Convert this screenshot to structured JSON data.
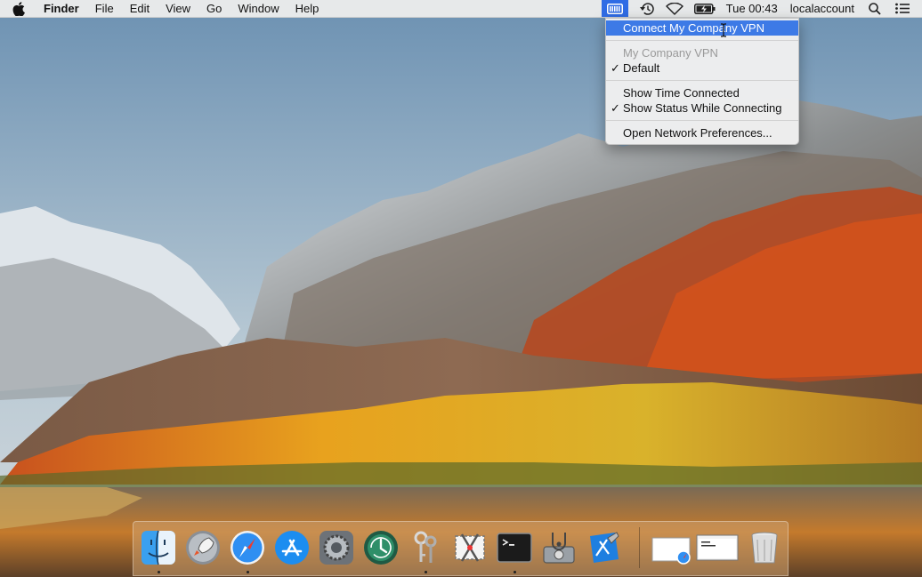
{
  "menubar": {
    "app_name": "Finder",
    "menus": [
      "File",
      "Edit",
      "View",
      "Go",
      "Window",
      "Help"
    ],
    "clock": "Tue 00:43",
    "user": "localaccount",
    "status_icons": [
      "vpn-icon",
      "time-machine-icon",
      "wifi-icon",
      "battery-icon",
      "spotlight-icon",
      "notification-center-icon"
    ]
  },
  "vpn_menu": {
    "items": [
      {
        "label": "Connect My Company VPN",
        "state": "highlighted"
      },
      {
        "label": "My Company VPN",
        "state": "disabled"
      },
      {
        "label": "Default",
        "checked": true
      },
      {
        "label": "Show Time Connected"
      },
      {
        "label": "Show Status While Connecting",
        "checked": true
      },
      {
        "label": "Open Network Preferences..."
      }
    ],
    "check_glyph": "✓"
  },
  "dock": {
    "apps": [
      "Finder",
      "Launchpad",
      "Safari",
      "App Store",
      "System Preferences",
      "Time Machine",
      "Keychain Access",
      "Screenshot",
      "Terminal",
      "Disk Utility",
      "Xcode"
    ],
    "running": [
      "Finder",
      "Safari",
      "Keychain Access",
      "Terminal"
    ],
    "documents": [
      "Safari window",
      "Terminal window"
    ],
    "trash": "Trash"
  }
}
